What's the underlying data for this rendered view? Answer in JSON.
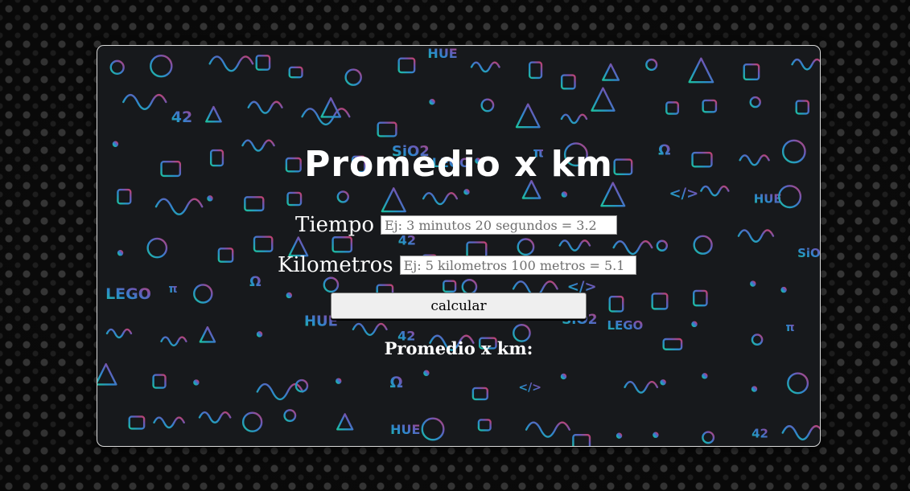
{
  "app": {
    "title": "Promedio x km"
  },
  "form": {
    "tiempo_label": "Tiempo",
    "tiempo_placeholder": "Ej: 3 minutos 20 segundos = 3.2",
    "tiempo_value": "",
    "km_label": "Kilometros",
    "km_placeholder": "Ej: 5 kilometros 100 metros = 5.1",
    "km_value": "",
    "submit_label": "calcular"
  },
  "result": {
    "label": "Promedio x km:",
    "value": ""
  },
  "background": {
    "doodle_words": [
      "HUE",
      "42",
      "SiO2",
      "LEGO",
      "π",
      "Ω",
      "</>"
    ],
    "gradient_colors": [
      "#1ec8a5",
      "#2f8ed6",
      "#6b5fc2",
      "#d1426e"
    ]
  }
}
